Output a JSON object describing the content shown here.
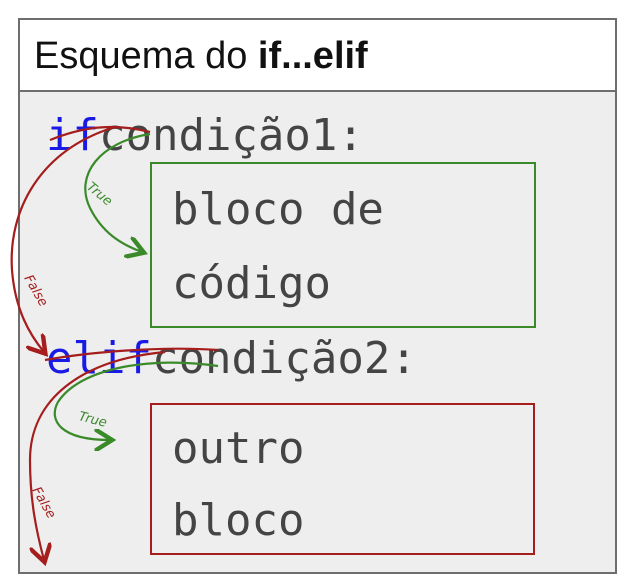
{
  "header": {
    "title_prefix": "Esquema do ",
    "title_bold": "if...elif"
  },
  "code": {
    "if_keyword": "if",
    "condition1": "condição1:",
    "block1_line1": "bloco de",
    "block1_line2": "código",
    "elif_keyword": "elif",
    "condition2": "condição2:",
    "block2_line1": "outro",
    "block2_line2": "bloco"
  },
  "arrows": {
    "true_label_1": "True",
    "false_label_1": "False",
    "true_label_2": "True",
    "false_label_2": "False"
  },
  "colors": {
    "keyword": "#1a1ae6",
    "true_arrow": "#3a8a2a",
    "false_arrow": "#a51d1d",
    "text": "#444444"
  }
}
